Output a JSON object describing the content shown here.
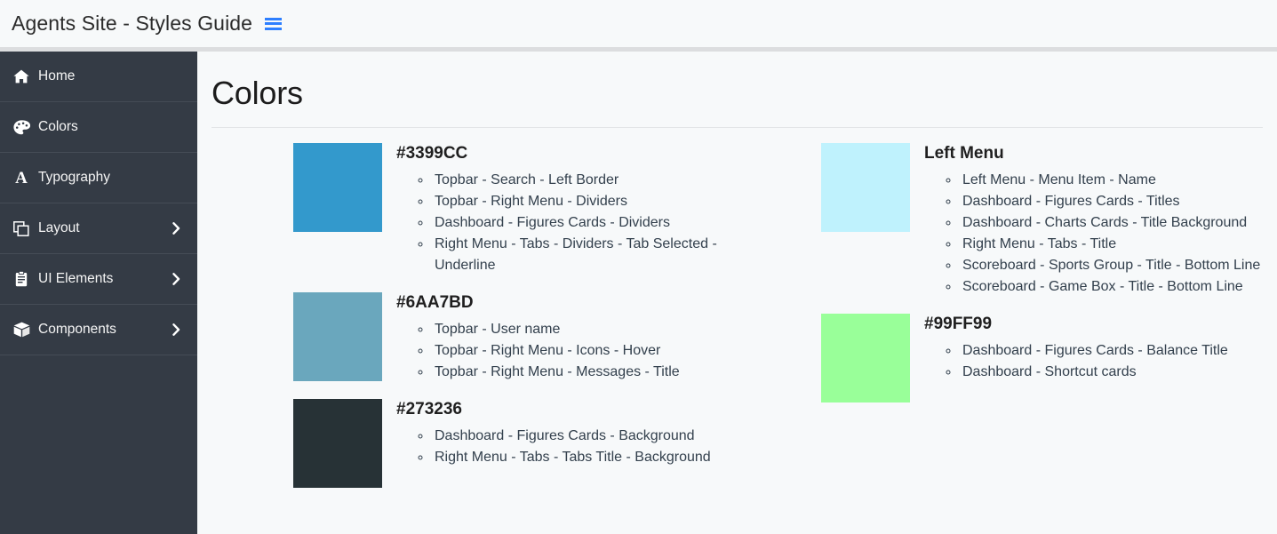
{
  "topbar": {
    "title": "Agents Site - Styles Guide",
    "menu_toggle_icon": "hamburger-icon"
  },
  "sidebar": {
    "items": [
      {
        "label": "Home",
        "icon": "home-icon",
        "has_arrow": false
      },
      {
        "label": "Colors",
        "icon": "palette-icon",
        "has_arrow": false
      },
      {
        "label": "Typography",
        "icon": "letter-a-icon",
        "has_arrow": false
      },
      {
        "label": "Layout",
        "icon": "layers-icon",
        "has_arrow": true,
        "arrow_icon": "chevron-right-icon"
      },
      {
        "label": "UI Elements",
        "icon": "clipboard-icon",
        "has_arrow": true,
        "arrow_icon": "chevron-right-icon"
      },
      {
        "label": "Components",
        "icon": "cube-icon",
        "has_arrow": true,
        "arrow_icon": "chevron-right-icon"
      }
    ]
  },
  "main": {
    "page_title": "Colors",
    "left_column": [
      {
        "heading": "#3399CC",
        "swatch_color": "#3399CC",
        "usages": [
          "Topbar - Search - Left Border",
          "Topbar - Right Menu - Dividers",
          "Dashboard - Figures Cards - Dividers",
          "Right Menu - Tabs - Dividers - Tab Selected - Underline"
        ]
      },
      {
        "heading": "#6AA7BD",
        "swatch_color": "#6AA7BD",
        "usages": [
          "Topbar - User name",
          "Topbar - Right Menu - Icons - Hover",
          "Topbar - Right Menu - Messages - Title"
        ]
      },
      {
        "heading": "#273236",
        "swatch_color": "#273236",
        "usages": [
          "Dashboard - Figures Cards - Background",
          "Right Menu - Tabs - Tabs Title - Background"
        ]
      }
    ],
    "right_column": [
      {
        "heading": "Left Menu",
        "swatch_color": "#BFF2FD",
        "usages": [
          "Left Menu - Menu Item - Name",
          "Dashboard - Figures Cards - Titles",
          "Dashboard - Charts Cards - Title Background",
          "Right Menu - Tabs - Title",
          "Scoreboard - Sports Group - Title - Bottom Line",
          "Scoreboard - Game Box - Title - Bottom Line"
        ]
      },
      {
        "heading": "#99FF99",
        "swatch_color": "#99FF99",
        "usages": [
          "Dashboard - Figures Cards - Balance Title",
          "Dashboard - Shortcut cards"
        ]
      }
    ]
  },
  "theme": {
    "sidebar_bg": "#343b45",
    "page_bg": "#f7f9fa",
    "accent_blue": "#2e7fff",
    "text_dark": "#1f1f1f",
    "list_text": "#33404d"
  }
}
